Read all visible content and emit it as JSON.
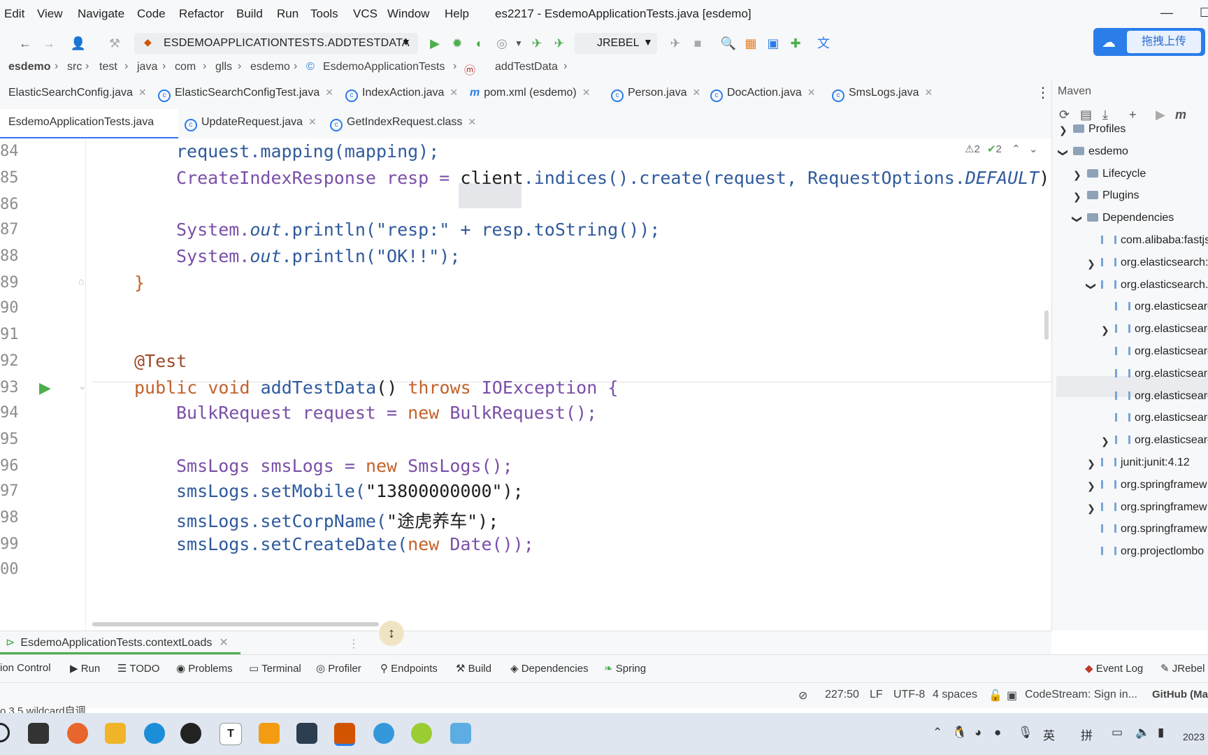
{
  "menu": [
    "Edit",
    "View",
    "Navigate",
    "Code",
    "Refactor",
    "Build",
    "Run",
    "Tools",
    "VCS",
    "Window",
    "Help"
  ],
  "window_title": "es2217 - EsdemoApplicationTests.java [esdemo]",
  "toolbar": {
    "run_config": "ESDEMOAPPLICATIONTESTS.ADDTESTDATA",
    "jrebel": "JREBEL",
    "upload_label": "拖拽上传"
  },
  "breadcrumb": [
    "esdemo",
    "src",
    "test",
    "java",
    "com",
    "glls",
    "esdemo",
    "EsdemoApplicationTests",
    "addTestData"
  ],
  "tabs_row1": [
    "ElasticSearchConfig.java",
    "ElasticSearchConfigTest.java",
    "IndexAction.java",
    "pom.xml (esdemo)",
    "Person.java",
    "DocAction.java",
    "SmsLogs.java"
  ],
  "tabs_row2": [
    "EsdemoApplicationTests.java",
    "UpdateRequest.java",
    "GetIndexRequest.class"
  ],
  "inspection": {
    "warnings": "2",
    "ok": "2"
  },
  "editor": {
    "line_numbers": [
      "84",
      "85",
      "86",
      "87",
      "88",
      "89",
      "90",
      "91",
      "92",
      "93",
      "94",
      "95",
      "96",
      "97",
      "98",
      "99",
      "00"
    ],
    "code": {
      "l84": "request.mapping(mapping);",
      "l85a": "CreateIndexResponse resp = ",
      "l85b": "client",
      "l85c": ".indices().create(request, RequestOptions.",
      "l85d": "DEFAULT",
      "l85e": ");",
      "l87a": "System.",
      "l87b": "out",
      "l87c": ".println(\"resp:\" + resp.toString());",
      "l88a": "System.",
      "l88b": "out",
      "l88c": ".println(\"OK!!\");",
      "l89": "}",
      "l92": "@Test",
      "l93a": "public void ",
      "l93b": "addTestData",
      "l93c": "() ",
      "l93d": "throws ",
      "l93e": "IOException {",
      "l94a": "BulkRequest request = ",
      "l94b": "new ",
      "l94c": "BulkRequest();",
      "l96a": "SmsLogs smsLogs = ",
      "l96b": "new ",
      "l96c": "SmsLogs();",
      "l97a": "smsLogs.setMobile(",
      "l97b": "\"13800000000\"",
      "l97c": ");",
      "l98a": "smsLogs.setCorpName(",
      "l98b": "\"途虎养车\"",
      "l98c": ");",
      "l99a": "smsLogs.setCreateDate(",
      "l99b": "new ",
      "l99c": "Date());"
    }
  },
  "maven": {
    "title": "Maven",
    "tree": [
      {
        "label": "Profiles",
        "arrow": "›"
      },
      {
        "label": "esdemo",
        "arrow": "⌄"
      },
      {
        "label": "Lifecycle",
        "arrow": "›"
      },
      {
        "label": "Plugins",
        "arrow": "›"
      },
      {
        "label": "Dependencies",
        "arrow": "⌄"
      },
      {
        "label": "com.alibaba:fastjs",
        "arrow": ""
      },
      {
        "label": "org.elasticsearch:e",
        "arrow": "›"
      },
      {
        "label": "org.elasticsearch.c",
        "arrow": "⌄"
      },
      {
        "label": "org.elasticsearc",
        "arrow": ""
      },
      {
        "label": "org.elasticsearc",
        "arrow": "›"
      },
      {
        "label": "org.elasticsearc",
        "arrow": ""
      },
      {
        "label": "org.elasticsearc",
        "arrow": ""
      },
      {
        "label": "org.elasticsearc",
        "arrow": ""
      },
      {
        "label": "org.elasticsearc",
        "arrow": ""
      },
      {
        "label": "org.elasticsearc",
        "arrow": "›"
      },
      {
        "label": "junit:junit:4.12",
        "arrow": "›"
      },
      {
        "label": "org.springframew",
        "arrow": "›"
      },
      {
        "label": "org.springframew",
        "arrow": "›"
      },
      {
        "label": "org.springframew",
        "arrow": ""
      },
      {
        "label": "org.projectlombo",
        "arrow": ""
      }
    ]
  },
  "run_tab": "EsdemoApplicationTests.contextLoads",
  "tool_windows": [
    "ion Control",
    "Run",
    "TODO",
    "Problems",
    "Terminal",
    "Profiler",
    "Endpoints",
    "Build",
    "Dependencies",
    "Spring"
  ],
  "tool_windows_right": [
    "Event Log",
    "JRebel C"
  ],
  "status": {
    "position": "227:50",
    "line_sep": "LF",
    "encoding": "UTF-8",
    "indent": "4 spaces",
    "codestream": "CodeStream: Sign in...",
    "github": "GitHub (Mat"
  },
  "cutoff_text": "o.3.5 wildcard自调",
  "tray": {
    "lang1": "英",
    "lang2": "拼",
    "year": "2023"
  }
}
